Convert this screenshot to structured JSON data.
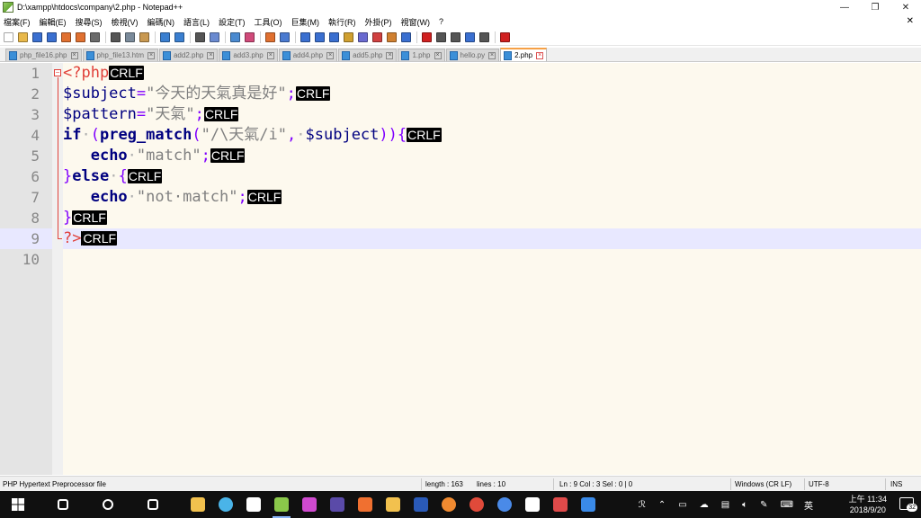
{
  "window": {
    "title": "D:\\xampp\\htdocs\\company\\2.php - Notepad++",
    "controls": {
      "minimize": "—",
      "maximize": "❐",
      "close": "✕"
    }
  },
  "menu": {
    "items": [
      "檔案(F)",
      "編輯(E)",
      "搜尋(S)",
      "檢視(V)",
      "編碼(N)",
      "語言(L)",
      "設定(T)",
      "工具(O)",
      "巨集(M)",
      "執行(R)",
      "外掛(P)",
      "視窗(W)",
      "?"
    ],
    "close_glyph": "✕"
  },
  "toolbar": {
    "colors": {
      "new": "#ffffff",
      "open": "#e8b84a",
      "save": "#3a6fd0",
      "saveall": "#3a6fd0",
      "close": "#e07030",
      "closeall": "#e07030",
      "print": "#6a6a6a",
      "cut": "#555555",
      "copy": "#7a8a9a",
      "paste": "#c89850",
      "undo": "#3a7fd0",
      "redo": "#3a7fd0",
      "find": "#555555",
      "replace": "#6a8ad0",
      "zoomin": "#4a8ad0",
      "zoomout": "#d04a7a",
      "sync_v": "#e07030",
      "sync_h": "#4a7ad0",
      "wrap": "#3a6fd0",
      "allchars": "#3a6fd0",
      "indent": "#3a6fd0",
      "udl": "#d0a030",
      "docmap": "#6a6ad0",
      "funclist": "#d04040",
      "folder": "#d08030",
      "monitor": "#3a6fd0",
      "record": "#d02020",
      "stop": "#555555",
      "play": "#555555",
      "playmulti": "#3a6fd0",
      "savemacro": "#555555",
      "spell": "#d02020"
    }
  },
  "tabs": [
    {
      "label": "php_file16.php",
      "active": false
    },
    {
      "label": "php_file13.htm",
      "active": false
    },
    {
      "label": "add2.php",
      "active": false
    },
    {
      "label": "add3.php",
      "active": false
    },
    {
      "label": "add4.php",
      "active": false
    },
    {
      "label": "add5.php",
      "active": false
    },
    {
      "label": "1.php",
      "active": false
    },
    {
      "label": "hello.py",
      "active": false
    },
    {
      "label": "2.php",
      "active": true
    }
  ],
  "editor": {
    "eol_marker": "CRLF",
    "line_numbers": [
      "1",
      "2",
      "3",
      "4",
      "5",
      "6",
      "7",
      "8",
      "9",
      "10"
    ],
    "current_line": 9,
    "lines": [
      {
        "tokens": [
          {
            "t": "php-tag",
            "v": "<?php"
          }
        ],
        "eol": true
      },
      {
        "tokens": [
          {
            "t": "var",
            "v": "$subject"
          },
          {
            "t": "op",
            "v": "="
          },
          {
            "t": "str",
            "v": "\"今天的天氣真是好\""
          },
          {
            "t": "op",
            "v": ";"
          }
        ],
        "eol": true
      },
      {
        "tokens": [
          {
            "t": "var",
            "v": "$pattern"
          },
          {
            "t": "op",
            "v": "="
          },
          {
            "t": "str",
            "v": "\"天氣\""
          },
          {
            "t": "op",
            "v": ";"
          }
        ],
        "eol": true
      },
      {
        "tokens": [
          {
            "t": "kw",
            "v": "if"
          },
          {
            "t": "ws",
            "v": "·"
          },
          {
            "t": "op",
            "v": "("
          },
          {
            "t": "fn",
            "v": "preg_match"
          },
          {
            "t": "op",
            "v": "("
          },
          {
            "t": "str",
            "v": "\"/\\天氣/i\""
          },
          {
            "t": "op",
            "v": ","
          },
          {
            "t": "ws",
            "v": "·"
          },
          {
            "t": "var",
            "v": "$subject"
          },
          {
            "t": "op",
            "v": ")){"
          }
        ],
        "eol": true
      },
      {
        "tokens": [
          {
            "t": "ws",
            "v": "   "
          },
          {
            "t": "kw",
            "v": "echo"
          },
          {
            "t": "ws",
            "v": "·"
          },
          {
            "t": "str",
            "v": "\"match\""
          },
          {
            "t": "op",
            "v": ";"
          }
        ],
        "eol": true
      },
      {
        "tokens": [
          {
            "t": "op",
            "v": "}"
          },
          {
            "t": "kw",
            "v": "else"
          },
          {
            "t": "ws",
            "v": "·"
          },
          {
            "t": "op",
            "v": "{"
          }
        ],
        "eol": true
      },
      {
        "tokens": [
          {
            "t": "ws",
            "v": "   "
          },
          {
            "t": "kw",
            "v": "echo"
          },
          {
            "t": "ws",
            "v": "·"
          },
          {
            "t": "str",
            "v": "\"not·match\""
          },
          {
            "t": "op",
            "v": ";"
          }
        ],
        "eol": true
      },
      {
        "tokens": [
          {
            "t": "op",
            "v": "}"
          }
        ],
        "eol": true
      },
      {
        "tokens": [
          {
            "t": "php-tag",
            "v": "?>"
          }
        ],
        "eol": true,
        "caret_before_eol": true
      },
      {
        "tokens": [],
        "eol": false
      }
    ]
  },
  "statusbar": {
    "filetype": "PHP Hypertext Preprocessor file",
    "length": "length : 163",
    "lines": "lines : 10",
    "position": "Ln : 9    Col : 3    Sel : 0 | 0",
    "eol": "Windows (CR LF)",
    "encoding": "UTF-8",
    "mode": "INS"
  },
  "taskbar": {
    "start_icon": "windows-logo-icon",
    "apps": [
      {
        "name": "back-arrow-icon",
        "color": "#ffffff"
      },
      {
        "name": "search-icon",
        "color": "#ffffff"
      },
      {
        "name": "task-view-icon",
        "color": "#ffffff"
      },
      {
        "name": "file-explorer-icon",
        "color": "#f2c14e"
      },
      {
        "name": "clock-app-icon",
        "color": "#4ab4e8"
      },
      {
        "name": "google-icon",
        "color": "#ffffff"
      },
      {
        "name": "notepad-plus-plus-icon",
        "color": "#8ac84a",
        "active": true
      },
      {
        "name": "app-multicolor-icon",
        "color": "#d04ad0"
      },
      {
        "name": "eclipse-icon",
        "color": "#5a4aa8"
      },
      {
        "name": "xampp-icon",
        "color": "#f07030"
      },
      {
        "name": "folder-app-icon",
        "color": "#f2c14e"
      },
      {
        "name": "powershell-icon",
        "color": "#2a5ab8"
      },
      {
        "name": "firefox-icon",
        "color": "#f08a30"
      },
      {
        "name": "chrome-icon",
        "color": "#e04a3a"
      },
      {
        "name": "chrome-alt-icon",
        "color": "#4a8ae8"
      },
      {
        "name": "reader-icon",
        "color": "#ffffff"
      },
      {
        "name": "paint-icon",
        "color": "#e04a4a"
      },
      {
        "name": "edge-icon",
        "color": "#3a8ae8"
      }
    ],
    "tray": {
      "people_glyph": "ℛ",
      "chevron_glyph": "⌃",
      "lang": "英",
      "time": "上午 11:34",
      "date": "2018/9/20",
      "notification_count": "32"
    }
  }
}
